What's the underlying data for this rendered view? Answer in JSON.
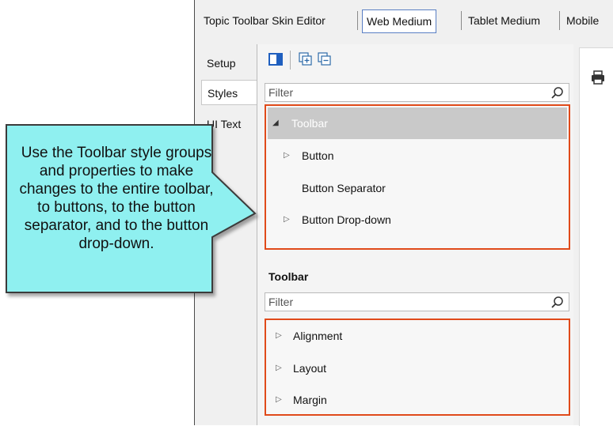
{
  "tabs": [
    {
      "label": "Topic Toolbar Skin Editor",
      "active": false
    },
    {
      "label": "Web Medium",
      "active": true
    },
    {
      "label": "Tablet Medium",
      "active": false
    },
    {
      "label": "Mobile",
      "active": false
    }
  ],
  "side_tabs": [
    {
      "label": "Setup",
      "active": false
    },
    {
      "label": "Styles",
      "active": true
    },
    {
      "label": "UI Text",
      "active": false
    }
  ],
  "styles_filter": {
    "placeholder": "Filter"
  },
  "style_groups": [
    {
      "label": "Toolbar",
      "expanded": true,
      "selected": true
    },
    {
      "label": "Button",
      "expandable": true
    },
    {
      "label": "Button Separator",
      "expandable": false
    },
    {
      "label": "Button Drop-down",
      "expandable": true
    }
  ],
  "properties_section_title": "Toolbar",
  "properties_filter": {
    "placeholder": "Filter"
  },
  "property_groups": [
    {
      "label": "Alignment"
    },
    {
      "label": "Layout"
    },
    {
      "label": "Margin"
    }
  ],
  "callout": {
    "text": "Use the Toolbar style groups and properties to make changes to the entire toolbar, to buttons, to the button separator, and to the button drop-down.",
    "fill": "#8ff0f0",
    "stroke": "#3a3a3a"
  },
  "colors": {
    "highlight_border": "#e04a1a",
    "selected_row": "#c9c9c9",
    "active_tab_border": "#5a7fc4"
  },
  "icons": [
    "single-pane-icon",
    "expand-all-icon",
    "collapse-all-icon",
    "search-icon",
    "print-icon"
  ]
}
